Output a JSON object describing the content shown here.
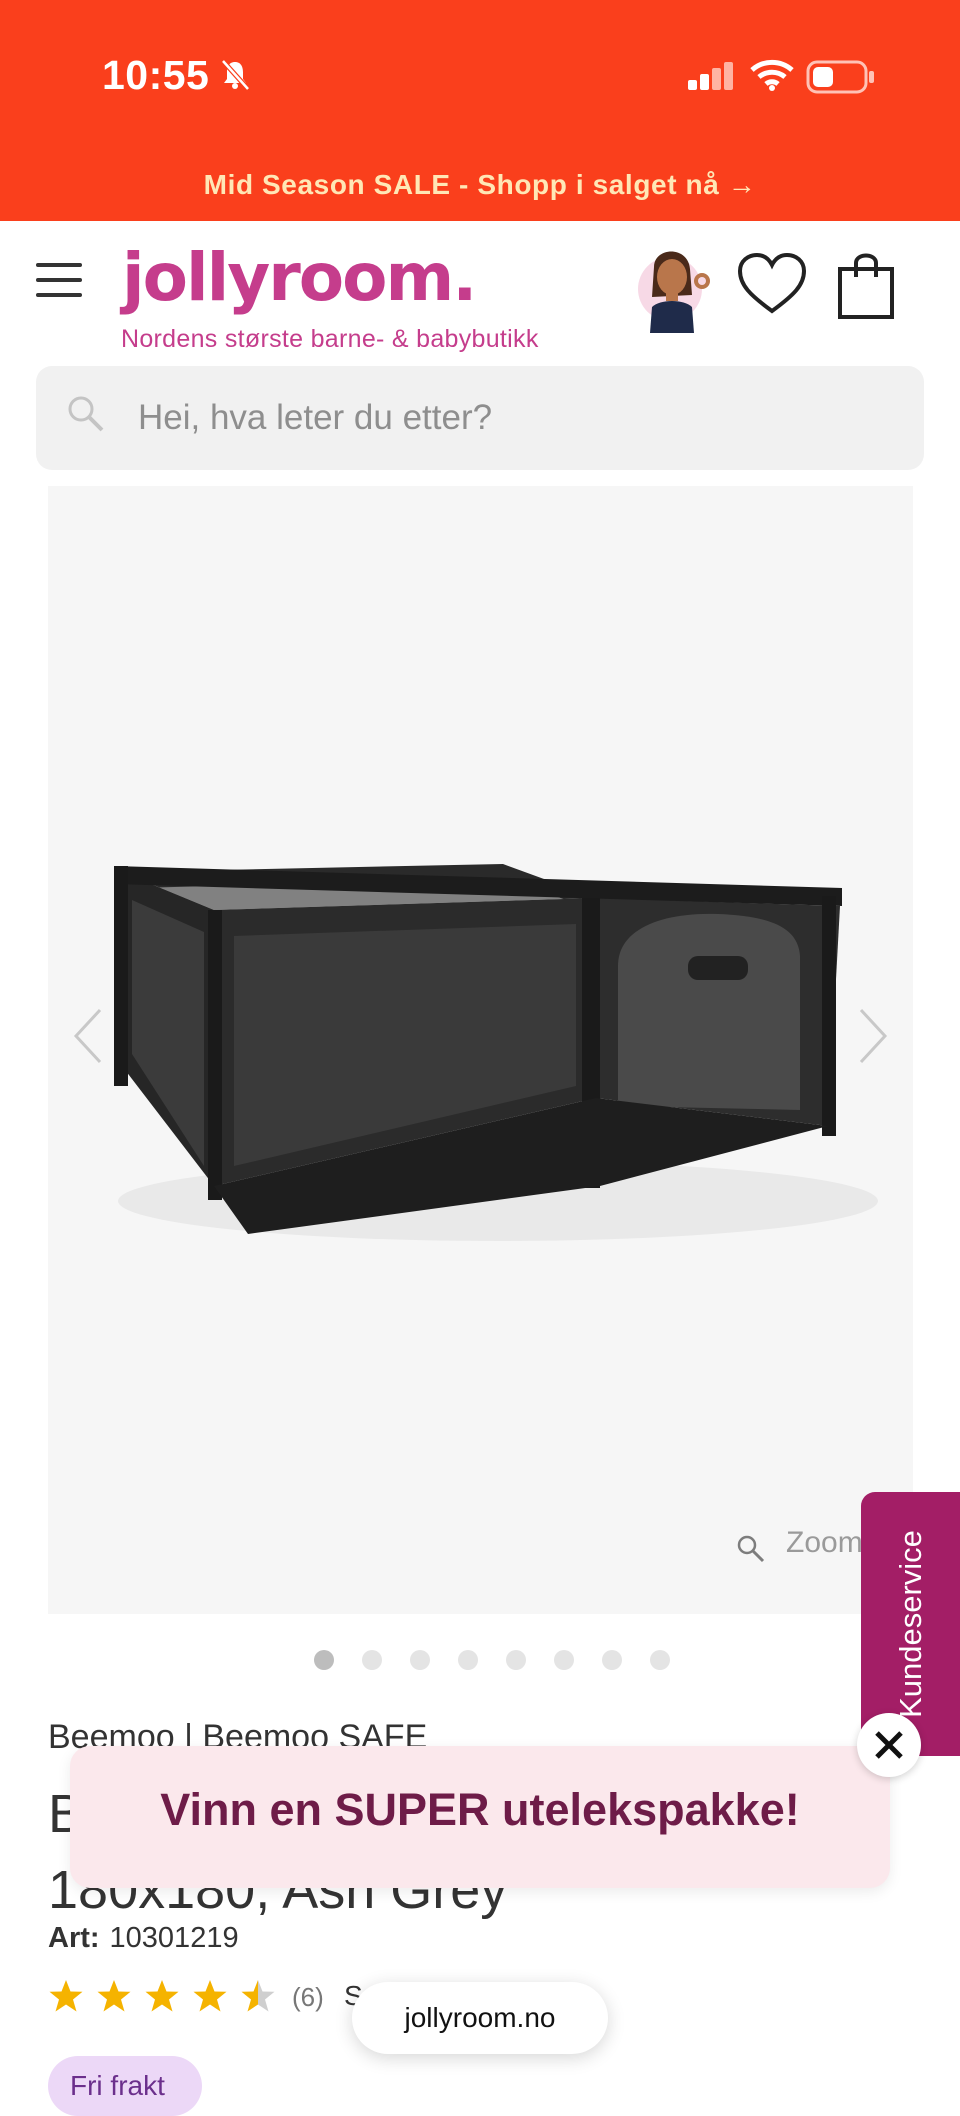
{
  "status_bar": {
    "time": "10:55"
  },
  "promo": {
    "text": "Mid Season SALE - Shopp i salget nå →"
  },
  "header": {
    "logo": "jollyroom.",
    "tagline": "Nordens største barne- & babybutikk"
  },
  "search": {
    "placeholder": "Hei, hva leter du etter?"
  },
  "gallery": {
    "zoom_label": "Zoom",
    "image_count": 8,
    "active_index": 0
  },
  "side_tab": {
    "label": "Kundeservice"
  },
  "product": {
    "brand": "Beemoo | Beemoo SAFE",
    "title_line1": "B",
    "title_line2": "180x180, Ash Grey",
    "art_label": "Art:",
    "art_number": "10301219",
    "rating": 4.5,
    "review_count": "(6)",
    "review_more": "S",
    "badge": "Fri frakt"
  },
  "popup": {
    "text": "Vinn en SUPER utelekspakke!"
  },
  "url_bar": {
    "domain": "jollyroom.no"
  },
  "colors": {
    "promo_bg": "#fa3f1c",
    "promo_text": "#ffe7b6",
    "brand_pink": "#c53d8c",
    "side_tab": "#a31e66",
    "popup_bg": "#fbe8ec",
    "popup_text": "#6e1c48",
    "star": "#f5b300"
  }
}
